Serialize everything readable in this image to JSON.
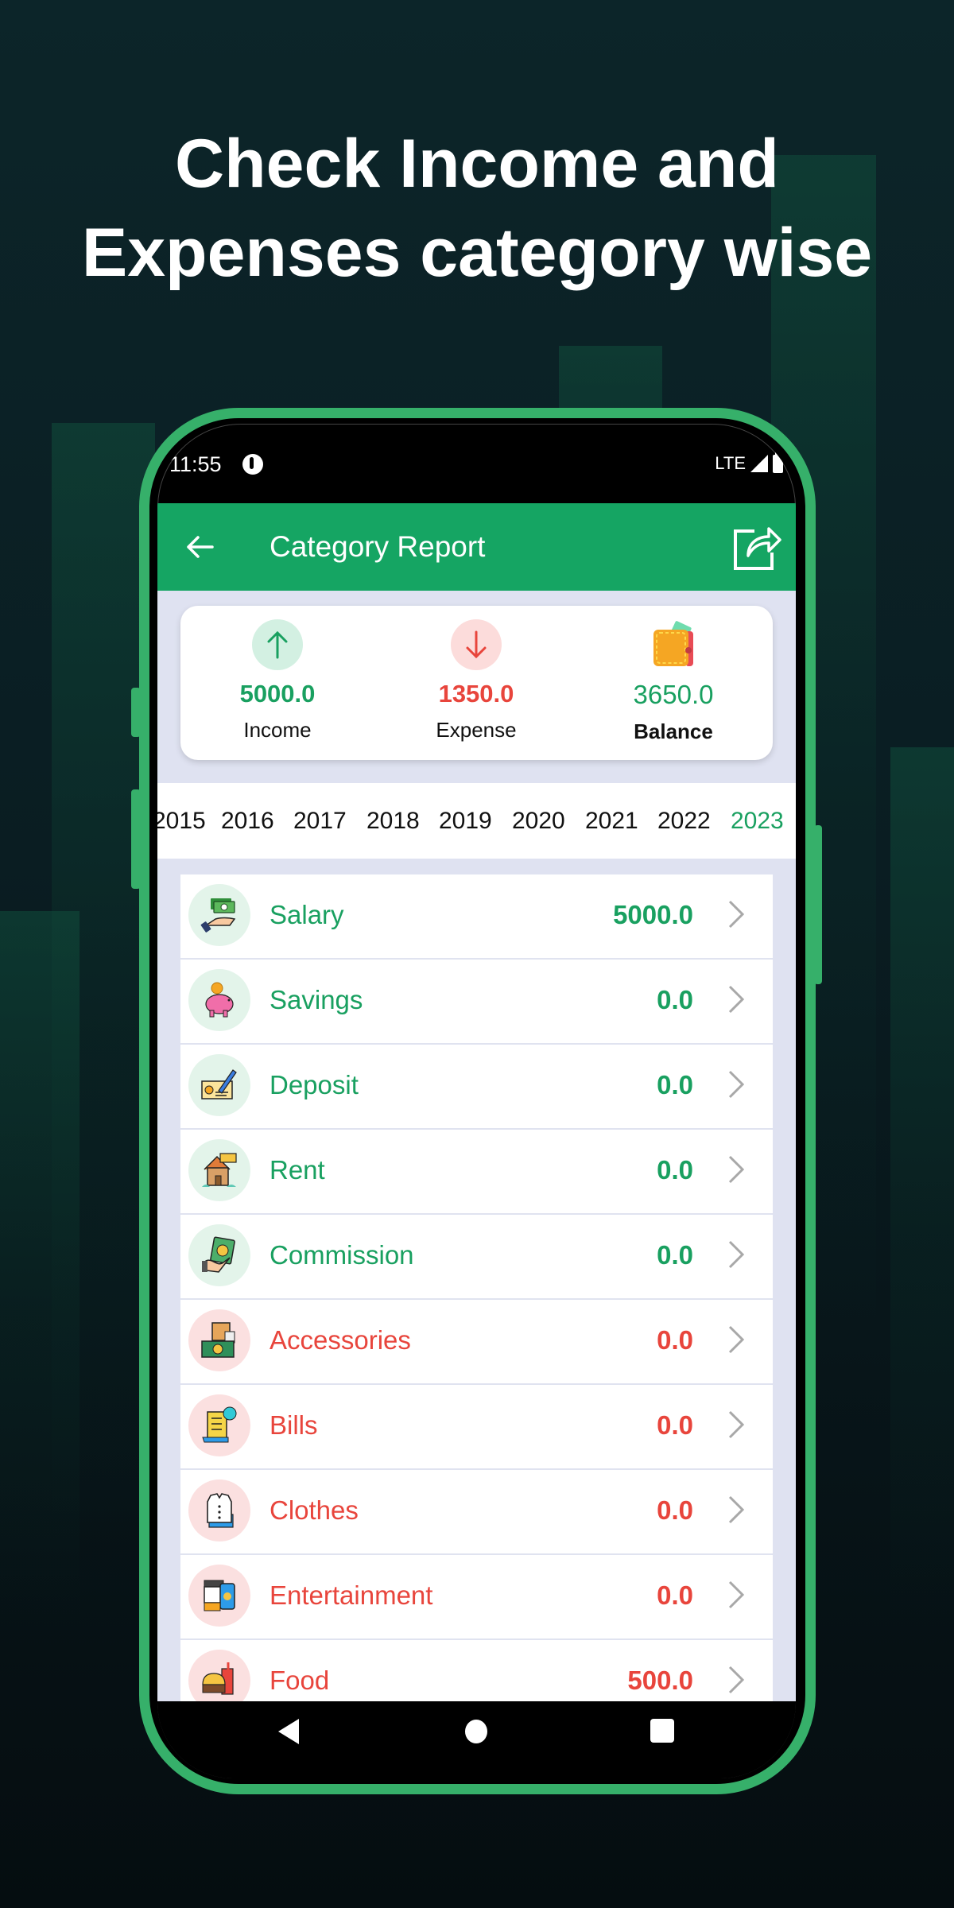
{
  "headline": {
    "line1": "Check Income and",
    "line2": "Expenses category wise"
  },
  "status_bar": {
    "time": "11:55",
    "network": "LTE",
    "icons": [
      "notification-dot-icon",
      "signal-icon",
      "battery-icon"
    ]
  },
  "app_bar": {
    "title": "Category Report",
    "back_icon": "arrow-left-icon",
    "share_icon": "share-export-icon"
  },
  "colors": {
    "primary": "#15a563",
    "income": "#19a060",
    "expense": "#e8453c",
    "background": "#dfe2f1",
    "phone_frame": "#36b06a"
  },
  "summary": {
    "income": {
      "value": "5000.0",
      "label": "Income",
      "icon": "arrow-up-icon"
    },
    "expense": {
      "value": "1350.0",
      "label": "Expense",
      "icon": "arrow-down-icon"
    },
    "balance": {
      "value": "3650.0",
      "label": "Balance",
      "icon": "wallet-icon"
    }
  },
  "years": {
    "items": [
      "2015",
      "2016",
      "2017",
      "2018",
      "2019",
      "2020",
      "2021",
      "2022",
      "2023"
    ],
    "selected": "2023"
  },
  "categories": [
    {
      "name": "Salary",
      "amount": "5000.0",
      "type": "income",
      "icon": "salary-money-hand-icon"
    },
    {
      "name": "Savings",
      "amount": "0.0",
      "type": "income",
      "icon": "piggy-bank-icon"
    },
    {
      "name": "Deposit",
      "amount": "0.0",
      "type": "income",
      "icon": "cheque-icon"
    },
    {
      "name": "Rent",
      "amount": "0.0",
      "type": "income",
      "icon": "rent-house-icon"
    },
    {
      "name": "Commission",
      "amount": "0.0",
      "type": "income",
      "icon": "commission-hand-icon"
    },
    {
      "name": "Accessories",
      "amount": "0.0",
      "type": "expense",
      "icon": "accessories-box-money-icon"
    },
    {
      "name": "Bills",
      "amount": "0.0",
      "type": "expense",
      "icon": "bill-receipt-icon"
    },
    {
      "name": "Clothes",
      "amount": "0.0",
      "type": "expense",
      "icon": "shirt-icon"
    },
    {
      "name": "Entertainment",
      "amount": "0.0",
      "type": "expense",
      "icon": "entertainment-icon"
    },
    {
      "name": "Food",
      "amount": "500.0",
      "type": "expense",
      "icon": "burger-drink-icon"
    }
  ],
  "nav_bar": {
    "buttons": [
      "back-nav-icon",
      "home-nav-icon",
      "recents-nav-icon"
    ]
  }
}
